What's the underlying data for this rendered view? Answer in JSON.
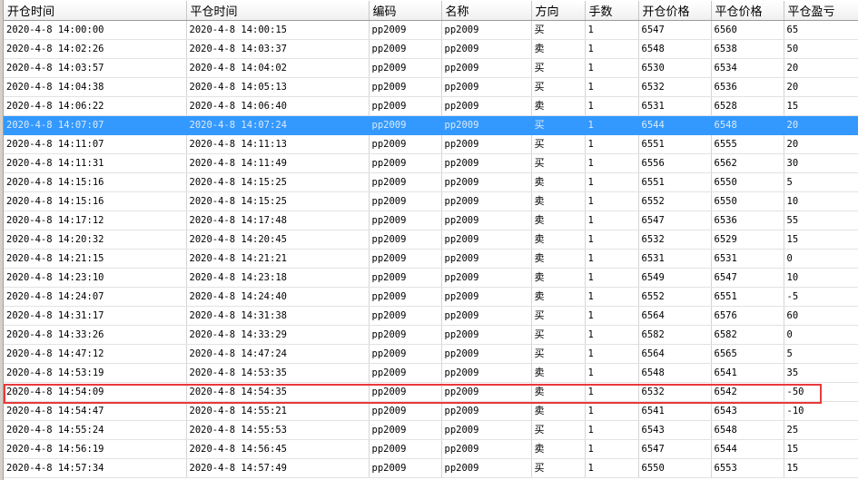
{
  "columns": [
    "开仓时间",
    "平仓时间",
    "编码",
    "名称",
    "方向",
    "手数",
    "开仓价格",
    "平仓价格",
    "平仓盈亏"
  ],
  "selected_row_index": 5,
  "annotated_row_index": 20,
  "colors": {
    "selection": "#3399ff",
    "annotation_box": "#e83a3a"
  },
  "rows": [
    [
      "2020-4-8 14:00:00",
      "2020-4-8 14:00:15",
      "pp2009",
      "pp2009",
      "买",
      "1",
      "6547",
      "6560",
      "65"
    ],
    [
      "2020-4-8 14:02:26",
      "2020-4-8 14:03:37",
      "pp2009",
      "pp2009",
      "卖",
      "1",
      "6548",
      "6538",
      "50"
    ],
    [
      "2020-4-8 14:03:57",
      "2020-4-8 14:04:02",
      "pp2009",
      "pp2009",
      "买",
      "1",
      "6530",
      "6534",
      "20"
    ],
    [
      "2020-4-8 14:04:38",
      "2020-4-8 14:05:13",
      "pp2009",
      "pp2009",
      "买",
      "1",
      "6532",
      "6536",
      "20"
    ],
    [
      "2020-4-8 14:06:22",
      "2020-4-8 14:06:40",
      "pp2009",
      "pp2009",
      "卖",
      "1",
      "6531",
      "6528",
      "15"
    ],
    [
      "2020-4-8 14:07:07",
      "2020-4-8 14:07:24",
      "pp2009",
      "pp2009",
      "买",
      "1",
      "6544",
      "6548",
      "20"
    ],
    [
      "2020-4-8 14:11:07",
      "2020-4-8 14:11:13",
      "pp2009",
      "pp2009",
      "买",
      "1",
      "6551",
      "6555",
      "20"
    ],
    [
      "2020-4-8 14:11:31",
      "2020-4-8 14:11:49",
      "pp2009",
      "pp2009",
      "买",
      "1",
      "6556",
      "6562",
      "30"
    ],
    [
      "2020-4-8 14:15:16",
      "2020-4-8 14:15:25",
      "pp2009",
      "pp2009",
      "卖",
      "1",
      "6551",
      "6550",
      "5"
    ],
    [
      "2020-4-8 14:15:16",
      "2020-4-8 14:15:25",
      "pp2009",
      "pp2009",
      "卖",
      "1",
      "6552",
      "6550",
      "10"
    ],
    [
      "2020-4-8 14:17:12",
      "2020-4-8 14:17:48",
      "pp2009",
      "pp2009",
      "卖",
      "1",
      "6547",
      "6536",
      "55"
    ],
    [
      "2020-4-8 14:20:32",
      "2020-4-8 14:20:45",
      "pp2009",
      "pp2009",
      "卖",
      "1",
      "6532",
      "6529",
      "15"
    ],
    [
      "2020-4-8 14:21:15",
      "2020-4-8 14:21:21",
      "pp2009",
      "pp2009",
      "卖",
      "1",
      "6531",
      "6531",
      "0"
    ],
    [
      "2020-4-8 14:23:10",
      "2020-4-8 14:23:18",
      "pp2009",
      "pp2009",
      "卖",
      "1",
      "6549",
      "6547",
      "10"
    ],
    [
      "2020-4-8 14:24:07",
      "2020-4-8 14:24:40",
      "pp2009",
      "pp2009",
      "卖",
      "1",
      "6552",
      "6551",
      "-5"
    ],
    [
      "2020-4-8 14:31:17",
      "2020-4-8 14:31:38",
      "pp2009",
      "pp2009",
      "买",
      "1",
      "6564",
      "6576",
      "60"
    ],
    [
      "2020-4-8 14:33:26",
      "2020-4-8 14:33:29",
      "pp2009",
      "pp2009",
      "买",
      "1",
      "6582",
      "6582",
      "0"
    ],
    [
      "2020-4-8 14:47:12",
      "2020-4-8 14:47:24",
      "pp2009",
      "pp2009",
      "买",
      "1",
      "6564",
      "6565",
      "5"
    ],
    [
      "2020-4-8 14:53:19",
      "2020-4-8 14:53:35",
      "pp2009",
      "pp2009",
      "卖",
      "1",
      "6548",
      "6541",
      "35"
    ],
    [
      "2020-4-8 14:54:09",
      "2020-4-8 14:54:35",
      "pp2009",
      "pp2009",
      "卖",
      "1",
      "6532",
      "6542",
      "-50"
    ],
    [
      "2020-4-8 14:54:47",
      "2020-4-8 14:55:21",
      "pp2009",
      "pp2009",
      "卖",
      "1",
      "6541",
      "6543",
      "-10"
    ],
    [
      "2020-4-8 14:55:24",
      "2020-4-8 14:55:53",
      "pp2009",
      "pp2009",
      "买",
      "1",
      "6543",
      "6548",
      "25"
    ],
    [
      "2020-4-8 14:56:19",
      "2020-4-8 14:56:45",
      "pp2009",
      "pp2009",
      "卖",
      "1",
      "6547",
      "6544",
      "15"
    ],
    [
      "2020-4-8 14:57:34",
      "2020-4-8 14:57:49",
      "pp2009",
      "pp2009",
      "买",
      "1",
      "6550",
      "6553",
      "15"
    ]
  ]
}
